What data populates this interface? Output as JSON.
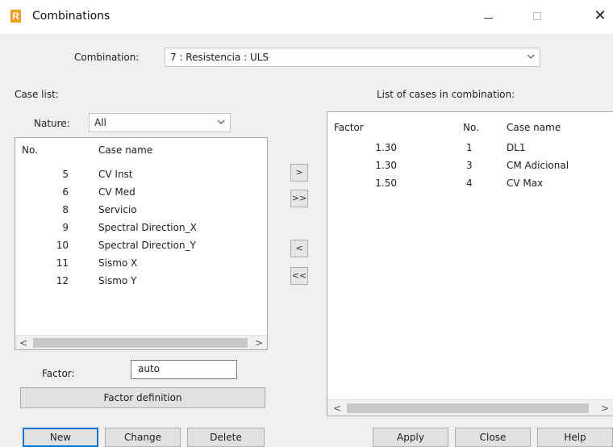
{
  "window": {
    "title": "Combinations",
    "app_icon_letter": "R",
    "minimize_glyph": "—",
    "close_glyph": "✕"
  },
  "combination": {
    "label": "Combination:",
    "selected": "7 : Resistencia : ULS"
  },
  "case_list": {
    "label": "Case list:",
    "nature_label": "Nature:",
    "nature_selected": "All",
    "columns": [
      "No.",
      "Case name"
    ],
    "rows": [
      {
        "no": "5",
        "name": "CV Inst"
      },
      {
        "no": "6",
        "name": "CV Med"
      },
      {
        "no": "8",
        "name": "Servicio"
      },
      {
        "no": "9",
        "name": "Spectral  Direction_X"
      },
      {
        "no": "10",
        "name": "Spectral  Direction_Y"
      },
      {
        "no": "11",
        "name": "Sismo X"
      },
      {
        "no": "12",
        "name": "Sismo Y"
      }
    ],
    "factor_label": "Factor:",
    "factor_value": "auto",
    "factor_definition_label": "Factor definition"
  },
  "transfer": {
    "add": ">",
    "add_all": ">>",
    "remove": "<",
    "remove_all": "<<"
  },
  "combination_cases": {
    "label": "List of cases in combination:",
    "columns": [
      "Factor",
      "No.",
      "Case name"
    ],
    "rows": [
      {
        "factor": "1.30",
        "no": "1",
        "name": "DL1"
      },
      {
        "factor": "1.30",
        "no": "3",
        "name": "CM Adicional"
      },
      {
        "factor": "1.50",
        "no": "4",
        "name": "CV Max"
      }
    ]
  },
  "buttons": {
    "new": "New",
    "change": "Change",
    "delete": "Delete",
    "apply": "Apply",
    "close": "Close",
    "help": "Help"
  },
  "scroll_arrows": {
    "left": "<",
    "right": ">"
  },
  "colors": {
    "window_bg": "#f0f0f0",
    "titlebar_bg": "#ffffff",
    "default_button_border": "#0078d7",
    "app_icon": "#f0a020"
  }
}
